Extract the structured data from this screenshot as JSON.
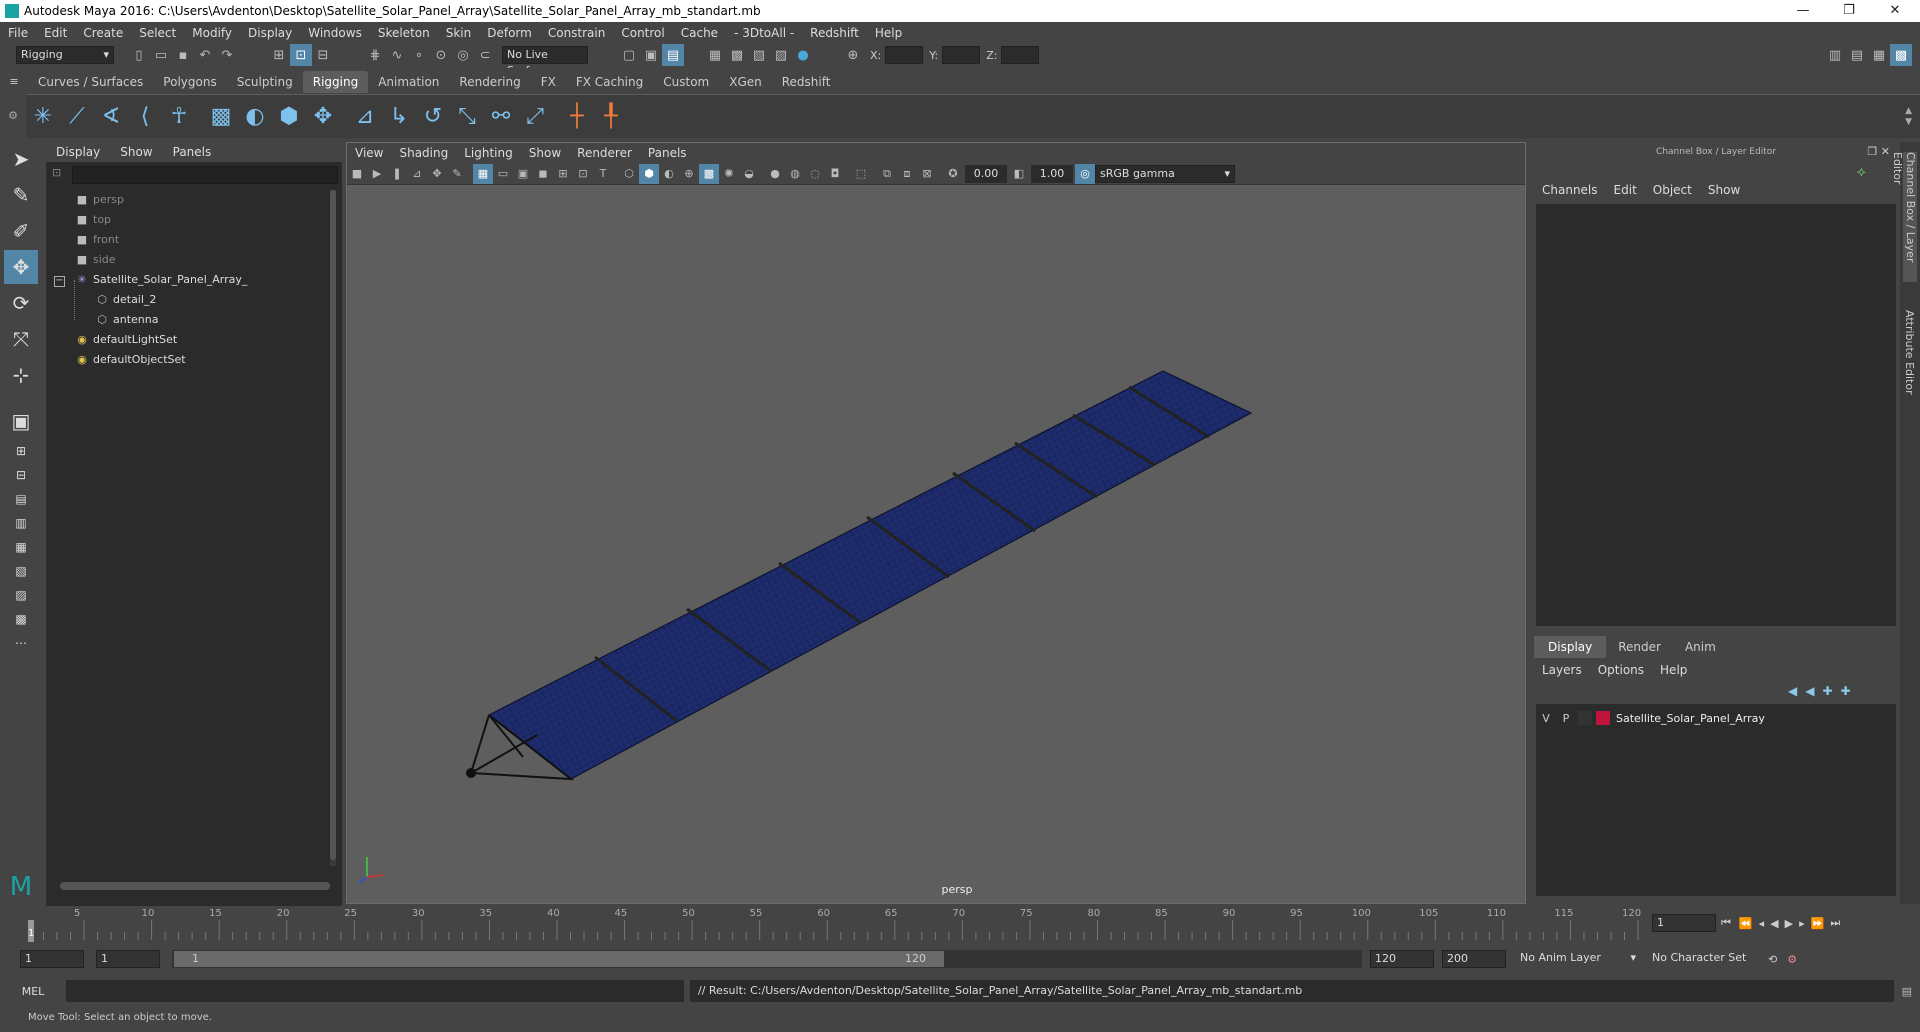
{
  "window": {
    "title": "Autodesk Maya 2016: C:\\Users\\Avdenton\\Desktop\\Satellite_Solar_Panel_Array\\Satellite_Solar_Panel_Array_mb_standart.mb",
    "minimize": "—",
    "maximize": "❐",
    "close": "✕"
  },
  "menubar": [
    "File",
    "Edit",
    "Create",
    "Select",
    "Modify",
    "Display",
    "Windows",
    "Skeleton",
    "Skin",
    "Deform",
    "Constrain",
    "Control",
    "Cache",
    "- 3DtoAll -",
    "Redshift",
    "Help"
  ],
  "statusline": {
    "mode": "Rigging",
    "live_surface": "No Live Surface",
    "x_label": "X:",
    "y_label": "Y:",
    "z_label": "Z:"
  },
  "shelf": {
    "tabs": [
      "Curves / Surfaces",
      "Polygons",
      "Sculpting",
      "Rigging",
      "Animation",
      "Rendering",
      "FX",
      "FX Caching",
      "Custom",
      "XGen",
      "Redshift"
    ],
    "active_tab": "Rigging"
  },
  "outliner": {
    "menu": [
      "Display",
      "Show",
      "Panels"
    ],
    "items": [
      {
        "label": "persp",
        "icon": "camera-icon",
        "dim": true
      },
      {
        "label": "top",
        "icon": "camera-icon",
        "dim": true
      },
      {
        "label": "front",
        "icon": "camera-icon",
        "dim": true
      },
      {
        "label": "side",
        "icon": "camera-icon",
        "dim": true
      },
      {
        "label": "Satellite_Solar_Panel_Array_",
        "icon": "group-icon",
        "dim": false
      },
      {
        "label": "detail_2",
        "icon": "mesh-icon",
        "dim": false
      },
      {
        "label": "antenna",
        "icon": "mesh-icon",
        "dim": false
      },
      {
        "label": "defaultLightSet",
        "icon": "set-icon",
        "dim": false
      },
      {
        "label": "defaultObjectSet",
        "icon": "set-icon",
        "dim": false
      }
    ]
  },
  "viewport": {
    "menu": [
      "View",
      "Shading",
      "Lighting",
      "Show",
      "Renderer",
      "Panels"
    ],
    "exposure": "0.00",
    "gamma": "1.00",
    "colorspace": "sRGB gamma",
    "camera_label": "persp"
  },
  "channelbox": {
    "title": "Channel Box / Layer Editor",
    "menu": [
      "Channels",
      "Edit",
      "Object",
      "Show"
    ],
    "layer_tabs": [
      "Display",
      "Render",
      "Anim"
    ],
    "layer_menu": [
      "Layers",
      "Options",
      "Help"
    ],
    "layer": {
      "v": "V",
      "p": "P",
      "name": "Satellite_Solar_Panel_Array",
      "color": "#c0143c"
    },
    "side_tabs": [
      "Channel Box / Layer Editor",
      "Attribute Editor"
    ]
  },
  "timeline": {
    "ticks": [
      "1",
      "5",
      "10",
      "15",
      "20",
      "25",
      "30",
      "35",
      "40",
      "45",
      "50",
      "55",
      "60",
      "65",
      "70",
      "75",
      "80",
      "85",
      "90",
      "95",
      "100",
      "105",
      "110",
      "115",
      "120"
    ],
    "current_frame": "1"
  },
  "range": {
    "start": "1",
    "playback_start": "1",
    "slider_start": "1",
    "slider_end": "120",
    "playback_end": "120",
    "end": "200",
    "anim_layer": "No Anim Layer",
    "character_set": "No Character Set"
  },
  "cmdline": {
    "lang": "MEL",
    "result": "// Result: C:/Users/Avdenton/Desktop/Satellite_Solar_Panel_Array/Satellite_Solar_Panel_Array_mb_standart.mb"
  },
  "helpline": "Move Tool: Select an object to move.",
  "colors": {
    "accent": "#5285a6",
    "panel_blue": "#1e2c6e"
  }
}
